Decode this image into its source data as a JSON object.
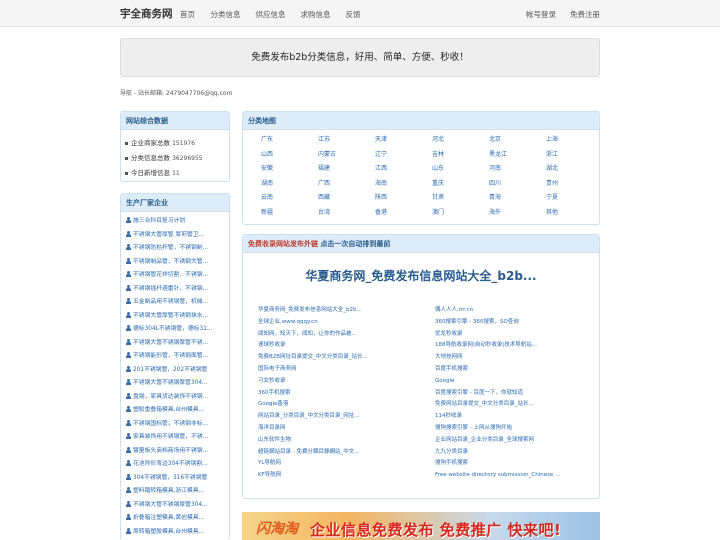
{
  "header": {
    "brand": "宇全商务网",
    "nav": [
      "首页",
      "分类信息",
      "供应信息",
      "求购信息",
      "反馈"
    ],
    "login": "帐号登录",
    "register": "免费注册"
  },
  "banner": {
    "text": "免费发布b2b分类信息，好用、简单、方便、秒收！"
  },
  "guide": {
    "text": "导航 - 站长邮箱: 2479047706@qq.com"
  },
  "stats": {
    "title": "网站综合数据",
    "items": [
      {
        "label": "企业商家总数",
        "value": "151976"
      },
      {
        "label": "分类信息总数",
        "value": "36296955"
      },
      {
        "label": "今日新增信息",
        "value": "11"
      }
    ]
  },
  "categories": {
    "title": "分类地图",
    "items": [
      "广东",
      "江苏",
      "天津",
      "河北",
      "北京",
      "上海",
      "山西",
      "内蒙古",
      "辽宁",
      "吉林",
      "黑龙江",
      "浙江",
      "安徽",
      "福建",
      "江西",
      "山东",
      "河南",
      "湖北",
      "湖南",
      "广西",
      "海南",
      "重庆",
      "四川",
      "贵州",
      "云南",
      "西藏",
      "陕西",
      "甘肃",
      "青海",
      "宁夏",
      "新疆",
      "台湾",
      "香港",
      "澳门",
      "海外",
      "其他"
    ]
  },
  "products": {
    "title": "生产厂家企业",
    "items": [
      "施三合科目复习计划",
      "不锈钢大管厚管 厚煎管卫...",
      "不锈钢防枯杆管，不锈钢制...",
      "不锈钢制品管，不锈钢大管...",
      "不锈钢管花祥切割，不锈钢...",
      "不锈钢插杆避雷针，不锈钢...",
      "五金制品用不锈钢管，机械...",
      "不锈钢大管厚管不锈钢抹水...",
      "德标304L不锈钢管，德标31...",
      "不锈钢大管不锈钢厚管不锈...",
      "不锈钢能形管，不锈钢面管...",
      "201不锈钢管，202不锈钢管",
      "不锈钢大管不锈钢厚管304...",
      "盘钢，家具货达装饰不锈钢...",
      "塑胶重叠箱模具,台州模具...",
      "不锈钢国标管，不锈钢非标...",
      "家具装饰用不锈钢管，不锈...",
      "镀量板头商档商场用不锈钢...",
      "花池异形弯边304不锈钢割...",
      "304不锈钢管，316不锈钢管",
      "塑料踏转箱模具,浙江模具...",
      "不锈钢大管不锈钢厚管304...",
      "折叠箱注塑模具,黄岩模具...",
      "周转箱塑胶模具,台州模具..."
    ]
  },
  "links": {
    "title_red": "免费收录网站发布外链",
    "title_blue": "点击一次自动排到最前",
    "featured": "华夏商务网_免费发布信息网站大全_b2b...",
    "items": [
      "华夏商务网_免费发布信息网站大全_b2b...",
      "偶人人人,rrr.cn",
      "全球企业,www.qqqy.cn",
      "360搜索引擎 - 360搜索，SO查询",
      "闻知网，知天下，闻知，让你的作品被...",
      "优龙秒收录",
      "速球秒收录",
      "188导航收录网|自动秒收录|技术导航站...",
      "免费B2B网址目录提交_中文分类目录_站长...",
      "大地技网网",
      "国际电子商务网",
      "百度手机搜索",
      "刁女秒收录",
      "Google",
      "360手机搜索",
      "百度搜索引擎 - 百度一下，你就知道",
      "Google香港",
      "免费网站目录提交_中文分类目录_站长...",
      "网站目录_分类目录_中文分类目录_网址...",
      "114秒收录",
      "海洋目录网",
      "搜狗搜索引擎 - 上网从搜狗开始",
      "山东软件生物",
      "企业网站目录_企业分类目录_全球搜索网",
      "超链網站目录 - 免費分類目錄網站_中文...",
      "九九分类目录",
      "YL导航网",
      "搜狗手机搜索",
      "KF导航网",
      "Free website directory submission_Chinese ..."
    ]
  },
  "ad": {
    "logo": "闪淘淘",
    "text": "企业信息免费发布  免费推广  快来吧!"
  }
}
